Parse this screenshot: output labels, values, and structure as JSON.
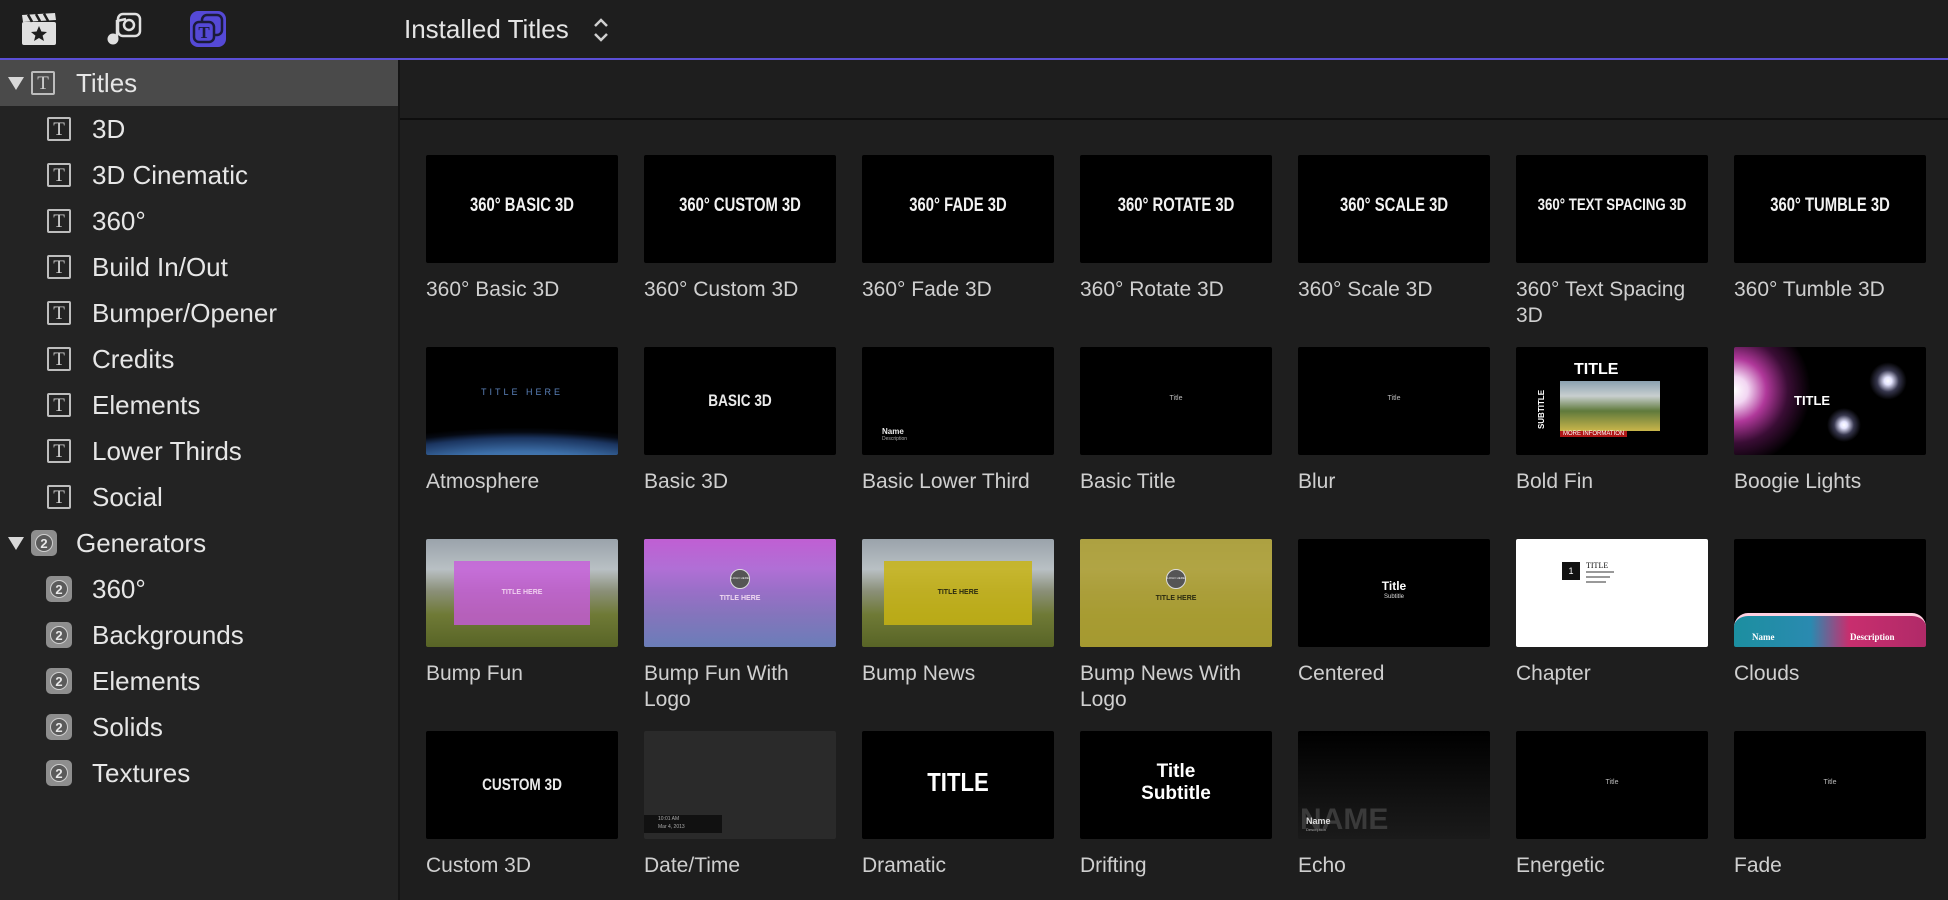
{
  "toolbar": {
    "browser_title": "Installed Titles",
    "icons": [
      "clapper-star-icon",
      "music-photo-icon",
      "titles-generators-icon"
    ],
    "accent_color": "#5549d6"
  },
  "sidebar": {
    "groups": [
      {
        "label": "Titles",
        "icon": "title-T-icon",
        "expanded": true,
        "selected": true,
        "items": [
          "3D",
          "3D Cinematic",
          "360°",
          "Build In/Out",
          "Bumper/Opener",
          "Credits",
          "Elements",
          "Lower Thirds",
          "Social"
        ]
      },
      {
        "label": "Generators",
        "icon": "generator-icon",
        "icon_glyph": "2",
        "expanded": true,
        "items": [
          "360°",
          "Backgrounds",
          "Elements",
          "Solids",
          "Textures"
        ]
      }
    ]
  },
  "grid": {
    "tiles": [
      {
        "name": "360° Basic 3D",
        "thumb_text": "360° BASIC 3D"
      },
      {
        "name": "360° Custom 3D",
        "thumb_text": "360° CUSTOM 3D"
      },
      {
        "name": "360° Fade 3D",
        "thumb_text": "360° FADE 3D"
      },
      {
        "name": "360° Rotate 3D",
        "thumb_text": "360° ROTATE 3D"
      },
      {
        "name": "360° Scale 3D",
        "thumb_text": "360° SCALE 3D"
      },
      {
        "name": "360° Text Spacing 3D",
        "thumb_text": "360° TEXT SPACING 3D"
      },
      {
        "name": "360° Tumble 3D",
        "thumb_text": "360° TUMBLE 3D"
      },
      {
        "name": "Atmosphere",
        "thumb_text": "TITLE HERE"
      },
      {
        "name": "Basic 3D",
        "thumb_text": "BASIC 3D"
      },
      {
        "name": "Basic Lower Third",
        "thumb_text": "Name",
        "thumb_sub": "Description"
      },
      {
        "name": "Basic Title",
        "thumb_text": "Title"
      },
      {
        "name": "Blur",
        "thumb_text": "Title"
      },
      {
        "name": "Bold Fin",
        "thumb_text": "TITLE",
        "thumb_sub": "SUBTITLE",
        "thumb_extra": "MORE INFORMATION"
      },
      {
        "name": "Boogie Lights",
        "thumb_text": "TITLE"
      },
      {
        "name": "Bump Fun",
        "thumb_text": "TITLE HERE"
      },
      {
        "name": "Bump Fun With Logo",
        "thumb_text": "TITLE HERE",
        "thumb_logo": "LOGO HERE"
      },
      {
        "name": "Bump News",
        "thumb_text": "TITLE HERE"
      },
      {
        "name": "Bump News With Logo",
        "thumb_text": "TITLE HERE",
        "thumb_logo": "LOGO HERE"
      },
      {
        "name": "Centered",
        "thumb_text": "Title",
        "thumb_sub": "Subtitle"
      },
      {
        "name": "Chapter",
        "thumb_text": "TITLE",
        "thumb_num": "1"
      },
      {
        "name": "Clouds",
        "thumb_text": "Name",
        "thumb_sub": "Description"
      },
      {
        "name": "Custom 3D",
        "thumb_text": "CUSTOM 3D"
      },
      {
        "name": "Date/Time",
        "thumb_text": "10:01 AM",
        "thumb_sub": "Mar 4, 2013"
      },
      {
        "name": "Dramatic",
        "thumb_text": "TITLE"
      },
      {
        "name": "Drifting",
        "thumb_text": "Title",
        "thumb_sub": "Subtitle"
      },
      {
        "name": "Echo",
        "thumb_text": "NAME",
        "thumb_sub": "Name",
        "thumb_extra": "Description"
      },
      {
        "name": "Energetic",
        "thumb_text": "Title"
      },
      {
        "name": "Fade",
        "thumb_text": "Title"
      }
    ]
  }
}
